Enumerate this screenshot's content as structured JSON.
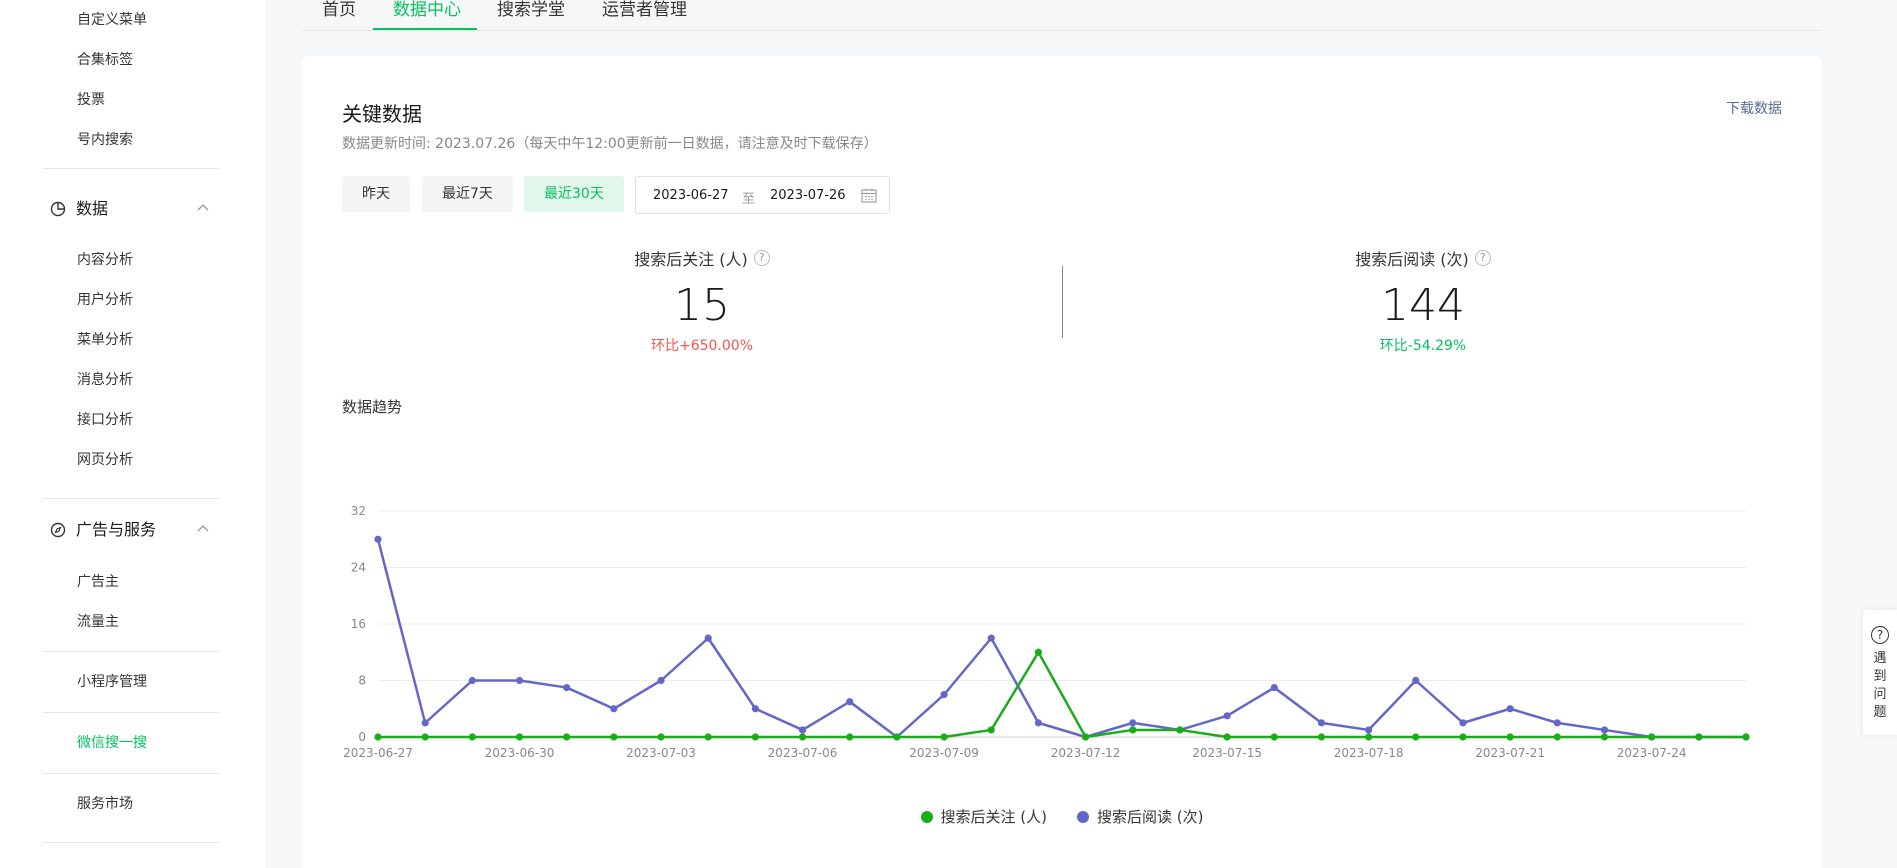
{
  "sidebar": {
    "top_items": [
      "自定义菜单",
      "合集标签",
      "投票",
      "号内搜索"
    ],
    "data_group": {
      "label": "数据",
      "icon": "pie-chart-icon",
      "items": [
        "内容分析",
        "用户分析",
        "菜单分析",
        "消息分析",
        "接口分析",
        "网页分析"
      ]
    },
    "ad_group": {
      "label": "广告与服务",
      "icon": "compass-icon",
      "items": [
        "广告主",
        "流量主"
      ]
    },
    "mini_program": "小程序管理",
    "wechat_search": "微信搜一搜",
    "service_market": "服务市场"
  },
  "tabs": [
    "首页",
    "数据中心",
    "搜索学堂",
    "运营者管理"
  ],
  "active_tab": 1,
  "card": {
    "title": "关键数据",
    "subtitle": "数据更新时间: 2023.07.26（每天中午12:00更新前一日数据，请注意及时下载保存）",
    "download": "下载数据",
    "buttons": [
      "昨天",
      "最近7天",
      "最近30天"
    ],
    "active_button": 2,
    "date_start": "2023-06-27",
    "date_sep": "至",
    "date_end": "2023-07-26"
  },
  "metrics": [
    {
      "label": "搜索后关注 (人)",
      "value": "15",
      "ratio": "环比+650.00%",
      "ratio_color": "#fa5151"
    },
    {
      "label": "搜索后阅读 (次)",
      "value": "144",
      "ratio": "环比-54.29%",
      "ratio_color": "#07c160"
    }
  ],
  "trend_title": "数据趋势",
  "help": {
    "icon": "question-icon",
    "text": "遇到问题"
  },
  "colors": {
    "accent": "#07c160",
    "follow_series": "#1aad19",
    "read_series": "#6467f0"
  },
  "chart_data": {
    "type": "line",
    "x": [
      "2023-06-27",
      "2023-06-28",
      "2023-06-29",
      "2023-06-30",
      "2023-07-01",
      "2023-07-02",
      "2023-07-03",
      "2023-07-04",
      "2023-07-05",
      "2023-07-06",
      "2023-07-07",
      "2023-07-08",
      "2023-07-09",
      "2023-07-10",
      "2023-07-11",
      "2023-07-12",
      "2023-07-13",
      "2023-07-14",
      "2023-07-15",
      "2023-07-16",
      "2023-07-17",
      "2023-07-18",
      "2023-07-19",
      "2023-07-20",
      "2023-07-21",
      "2023-07-22",
      "2023-07-23",
      "2023-07-24",
      "2023-07-25",
      "2023-07-26"
    ],
    "x_tick_labels": [
      "2023-06-27",
      "2023-06-30",
      "2023-07-03",
      "2023-07-06",
      "2023-07-09",
      "2023-07-12",
      "2023-07-15",
      "2023-07-18",
      "2023-07-21",
      "2023-07-24"
    ],
    "y_ticks": [
      0,
      8,
      16,
      24,
      32
    ],
    "ylim": [
      0,
      32
    ],
    "grid": true,
    "legend": "bottom-center",
    "series": [
      {
        "name": "搜索后关注 (人)",
        "color": "#1aad19",
        "values": [
          0,
          0,
          0,
          0,
          0,
          0,
          0,
          0,
          0,
          0,
          0,
          0,
          0,
          1,
          12,
          0,
          1,
          1,
          0,
          0,
          0,
          0,
          0,
          0,
          0,
          0,
          0,
          0,
          0,
          0
        ]
      },
      {
        "name": "搜索后阅读 (次)",
        "color": "#6467c8",
        "values": [
          28,
          2,
          8,
          8,
          7,
          4,
          8,
          14,
          4,
          1,
          5,
          0,
          6,
          14,
          2,
          0,
          2,
          1,
          3,
          7,
          2,
          1,
          8,
          2,
          4,
          2,
          1,
          0,
          0,
          0
        ]
      }
    ]
  }
}
